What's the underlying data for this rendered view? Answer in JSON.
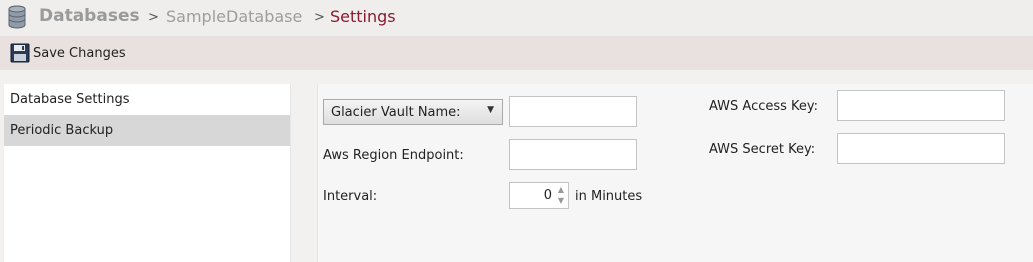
{
  "breadcrumb": {
    "root": "Databases",
    "separator": ">",
    "database": "SampleDatabase",
    "current": "Settings"
  },
  "toolbar": {
    "save_label": "Save Changes"
  },
  "menu": {
    "items": [
      {
        "label": "Database Settings",
        "selected": false
      },
      {
        "label": "Periodic Backup",
        "selected": true
      }
    ]
  },
  "form": {
    "vault_select": {
      "value": "Glacier Vault Name:"
    },
    "vault_input": {
      "value": ""
    },
    "region_label": "Aws Region Endpoint:",
    "region_input": {
      "value": ""
    },
    "interval_label": "Interval:",
    "interval_value": "0",
    "interval_unit": "in Minutes",
    "access_key_label": "AWS Access Key:",
    "access_key_input": {
      "value": ""
    },
    "secret_key_label": "AWS Secret Key:",
    "secret_key_input": {
      "value": ""
    }
  },
  "icons": {
    "database": "database-icon",
    "save": "floppy-disk-icon",
    "dropdown": "triangle-down-icon",
    "spinner": "spinner-arrows-icon"
  },
  "colors": {
    "current_crumb": "#8b1a2f",
    "toolbar_bg": "#e8e1df",
    "selected_menu_bg": "#d7d7d7"
  }
}
